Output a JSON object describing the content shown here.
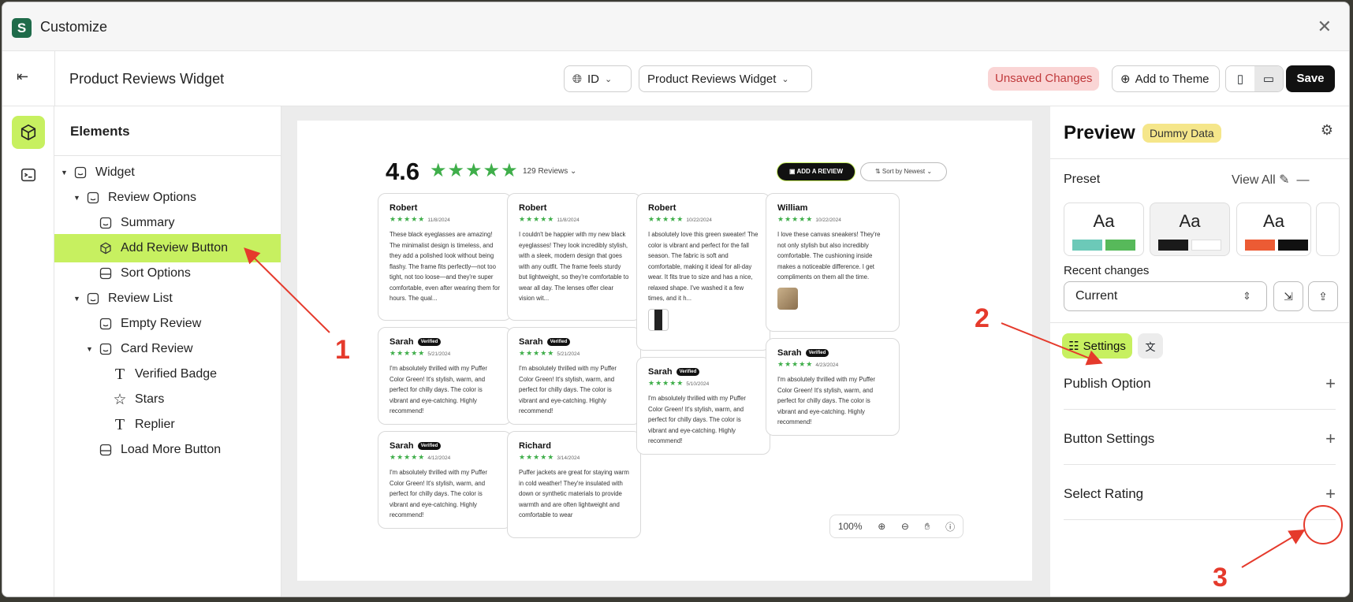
{
  "window": {
    "title": "Customize",
    "close_glyph": "✕"
  },
  "toolbar": {
    "page_title": "Product Reviews Widget",
    "lang_value": "ID",
    "widget_select": "Product Reviews Widget",
    "unsaved": "Unsaved Changes",
    "add_to_theme": "Add to Theme",
    "save": "Save"
  },
  "tree": {
    "heading": "Elements",
    "nodes": [
      {
        "label": "Widget"
      },
      {
        "label": "Review Options"
      },
      {
        "label": "Summary"
      },
      {
        "label": "Add Review Button"
      },
      {
        "label": "Sort Options"
      },
      {
        "label": "Review List"
      },
      {
        "label": "Empty Review"
      },
      {
        "label": "Card Review"
      },
      {
        "label": "Verified Badge"
      },
      {
        "label": "Stars"
      },
      {
        "label": "Replier"
      },
      {
        "label": "Load More Button"
      }
    ]
  },
  "preview_widget": {
    "rating": "4.6",
    "stars": "★★★★★",
    "review_count": "129 Reviews",
    "add_review": "ADD A REVIEW",
    "sort": "Sort by Newest",
    "verified": "Verified",
    "card_stars": "★★★★★",
    "cards": [
      {
        "name": "Robert",
        "date": "11/8/2024",
        "text": "These black eyeglasses are amazing! The minimalist design is timeless, and they add a polished look without being flashy. The frame fits perfectly—not too tight, not too loose—and they're super comfortable, even after wearing them for hours. The qual..."
      },
      {
        "name": "Robert",
        "date": "11/8/2024",
        "text": "I couldn't be happier with my new black eyeglasses! They look incredibly stylish, with a sleek, modern design that goes with any outfit. The frame feels sturdy but lightweight, so they're comfortable to wear all day. The lenses offer clear vision wit..."
      },
      {
        "name": "Robert",
        "date": "10/22/2024",
        "text": "I absolutely love this green sweater! The color is vibrant and perfect for the fall season. The fabric is soft and comfortable, making it ideal for all-day wear. It fits true to size and has a nice, relaxed shape. I've washed it a few times, and it h..."
      },
      {
        "name": "William",
        "date": "10/22/2024",
        "text": "I love these canvas sneakers! They're not only stylish but also incredibly comfortable. The cushioning inside makes a noticeable difference. I get compliments on them all the time."
      },
      {
        "name": "Sarah",
        "date": "5/21/2024",
        "text": "I'm absolutely thrilled with my Puffer Color Green! It's stylish, warm, and perfect for chilly days. The color is vibrant and eye-catching. Highly recommend!"
      },
      {
        "name": "Sarah",
        "date": "5/21/2024",
        "text": "I'm absolutely thrilled with my Puffer Color Green! It's stylish, warm, and perfect for chilly days. The color is vibrant and eye-catching. Highly recommend!"
      },
      {
        "name": "Sarah",
        "date": "5/10/2024",
        "text": "I'm absolutely thrilled with my Puffer Color Green! It's stylish, warm, and perfect for chilly days. The color is vibrant and eye-catching. Highly recommend!"
      },
      {
        "name": "Sarah",
        "date": "4/23/2024",
        "text": "I'm absolutely thrilled with my Puffer Color Green! It's stylish, warm, and perfect for chilly days. The color is vibrant and eye-catching. Highly recommend!"
      },
      {
        "name": "Sarah",
        "date": "4/12/2024",
        "text": "I'm absolutely thrilled with my Puffer Color Green! It's stylish, warm, and perfect for chilly days. The color is vibrant and eye-catching. Highly recommend!"
      },
      {
        "name": "Richard",
        "date": "3/14/2024",
        "text": "Puffer jackets are great for staying warm in cold weather! They're insulated with down or synthetic materials to provide warmth and are often lightweight and comfortable to wear"
      }
    ],
    "zoom": "100%"
  },
  "panel": {
    "title": "Preview",
    "dummy": "Dummy Data",
    "preset_label": "Preset",
    "view_all": "View All",
    "preset_aa": "Aa",
    "recent_label": "Recent changes",
    "recent_value": "Current",
    "settings_tab": "Settings",
    "sections": [
      "Publish Option",
      "Button Settings",
      "Select Rating"
    ]
  },
  "annotations": [
    "1",
    "2",
    "3"
  ],
  "colors": {
    "accent": "#c7f060",
    "star": "#3fae4a",
    "annotation": "#e53a2c"
  }
}
